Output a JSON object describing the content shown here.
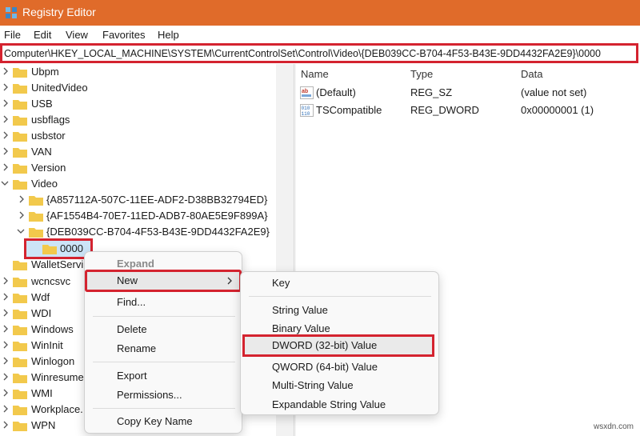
{
  "window": {
    "title": "Registry Editor"
  },
  "menu": [
    "File",
    "Edit",
    "View",
    "Favorites",
    "Help"
  ],
  "address": "Computer\\HKEY_LOCAL_MACHINE\\SYSTEM\\CurrentControlSet\\Control\\Video\\{DEB039CC-B704-4F53-B43E-9DD4432FA2E9}\\0000",
  "tree": {
    "items": [
      "Ubpm",
      "UnitedVideo",
      "USB",
      "usbflags",
      "usbstor",
      "VAN",
      "Version",
      "Video",
      "{A857112A-507C-11EE-ADF2-D38BB32794ED}",
      "{AF1554B4-70E7-11ED-ADB7-80AE5E9F899A}",
      "{DEB039CC-B704-4F53-B43E-9DD4432FA2E9}",
      "0000",
      "WalletServi",
      "wcncsvc",
      "Wdf",
      "WDI",
      "Windows",
      "WinInit",
      "Winlogon",
      "Winresume",
      "WMI",
      "Workplace.",
      "WPN"
    ]
  },
  "values": {
    "headers": {
      "name": "Name",
      "type": "Type",
      "data": "Data"
    },
    "rows": [
      {
        "name": "(Default)",
        "type": "REG_SZ",
        "data": "(value not set)",
        "icon": "string-value-icon"
      },
      {
        "name": "TSCompatible",
        "type": "REG_DWORD",
        "data": "0x00000001 (1)",
        "icon": "binary-value-icon"
      }
    ]
  },
  "context_menu": {
    "items": [
      "Expand",
      "New",
      "Find...",
      "Delete",
      "Rename",
      "Export",
      "Permissions...",
      "Copy Key Name"
    ]
  },
  "submenu": {
    "items": [
      "Key",
      "String Value",
      "Binary Value",
      "DWORD (32-bit) Value",
      "QWORD (64-bit) Value",
      "Multi-String Value",
      "Expandable String Value"
    ]
  },
  "watermark": "wsxdn.com",
  "colors": {
    "titlebar": "#e06b2a",
    "highlight_border": "#d4232f",
    "folder": "#f2c94c",
    "selection": "#cce4f7"
  }
}
